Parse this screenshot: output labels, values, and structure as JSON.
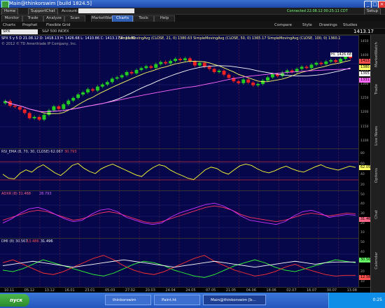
{
  "window": {
    "title": "Main@thinkorswim [build 1824.5]",
    "minimize": "_",
    "maximize": "□",
    "close": "×"
  },
  "toolbar": {
    "home": "Home",
    "support_chat": "SupportChat",
    "account_label": "Account:",
    "status": "Connected 22.08.12 00:25:11 CDT",
    "setup": "Setup"
  },
  "nav_tabs": [
    {
      "label": "Monitor"
    },
    {
      "label": "Trade"
    },
    {
      "label": "Analyze"
    },
    {
      "label": "Scan"
    },
    {
      "label": "MarketWatch"
    },
    {
      "label": "Charts",
      "active": true
    },
    {
      "label": "Tools"
    },
    {
      "label": "Help"
    }
  ],
  "subbar": {
    "charts": "Charts",
    "prophet": "Prophet",
    "flexible_grid": "Flexible Grid",
    "style": "Style",
    "drawings": "Drawings",
    "studies": "Studies",
    "zoom": "Zoom",
    "compare": "Compare"
  },
  "symbol": {
    "value": "SPX",
    "description": "S&P 500 INDEX",
    "last": "1413.17"
  },
  "price_pane": {
    "header": "SPX 5 y 5 D   21.08.12 O: 1418.13  H: 1426.68  L: 1410.86  C: 1413.17  R: 15.82",
    "studies": "SimpleMovingAvg (CLOSE, 21, 0)  1380.63   SimpleMovingAvg (CLOSE, 50, 0)  1365.17   SimpleMovingAvg (CLOSE, 100, 0)  1360.1",
    "copyright": "© 2012 © TD Ameritrade IP Company, Inc.",
    "hi_label": "Hi: 1426.68",
    "tags": [
      {
        "text": "1413.17",
        "color": "#ff5050"
      },
      {
        "text": "1380.63",
        "color": "#ffff66"
      },
      {
        "text": "1365.17",
        "color": "#ffffff"
      },
      {
        "text": "1331.87",
        "color": "#ff66ff"
      }
    ],
    "axis": [
      "1450",
      "1400",
      "1350",
      "1300",
      "1250",
      "1200",
      "1150",
      "1100"
    ]
  },
  "rsi_pane": {
    "header": "RSI_EMA (8, 70, 30, CLOSE)  62.067",
    "header_val2": "30.793",
    "tag": "62.0589",
    "axis": [
      "80",
      "60",
      "40",
      "20"
    ]
  },
  "adx_pane": {
    "header": "ADXR (8)  31.468",
    "header_val2": "28.793",
    "tag": "31.4654",
    "axis": [
      "50",
      "40",
      "30",
      "20",
      "10"
    ]
  },
  "dmi_pane": {
    "header": "DMI (8)  30.567",
    "header_val2": "13.486",
    "header_val3": "31.496",
    "tags": [
      {
        "text": "30.5689",
        "color": "#66ff66"
      },
      {
        "text": "12.5899",
        "color": "#ff5050"
      }
    ],
    "axis": [
      "50",
      "40",
      "30",
      "20",
      "10"
    ]
  },
  "xaxis": [
    "10.11",
    "05.12",
    "13.12",
    "16.01",
    "23.01",
    "05.03",
    "27.02",
    "20.03",
    "24.04",
    "24.05",
    "07.05",
    "21.05",
    "04.06",
    "18.06",
    "02.07",
    "16.07",
    "30.07",
    "13.08"
  ],
  "sidebar": [
    "MarketWatch",
    "Trade",
    "Live News",
    "Options",
    "Chat",
    "Calendar"
  ],
  "taskbar": {
    "start": "пуск",
    "tasks": [
      {
        "label": "thinkorswim"
      },
      {
        "label": "Paint.ht"
      },
      {
        "label": "Main@thinkorswim [b..."
      }
    ],
    "clock": "0:25"
  },
  "chart_data": [
    {
      "type": "candlestick",
      "title": "SPX",
      "note": "approximate daily closes read from gridlines",
      "ylim": [
        1100,
        1450
      ],
      "values": [
        1250,
        1232,
        1228,
        1218,
        1205,
        1185,
        1190,
        1180,
        1198,
        1215,
        1230,
        1220,
        1238,
        1252,
        1262,
        1275,
        1283,
        1295,
        1290,
        1305,
        1313,
        1322,
        1335,
        1340,
        1348,
        1360,
        1355,
        1368,
        1375,
        1382,
        1376,
        1390,
        1398,
        1393,
        1402,
        1410,
        1405,
        1412,
        1400,
        1385,
        1395,
        1380,
        1372,
        1360,
        1365,
        1350,
        1338,
        1325,
        1318,
        1332,
        1320,
        1310,
        1315,
        1328,
        1340,
        1352,
        1345,
        1358,
        1366,
        1360,
        1372,
        1380,
        1375,
        1388,
        1395,
        1390,
        1400,
        1405,
        1398,
        1410,
        1418,
        1413
      ]
    },
    {
      "type": "line",
      "title": "RSI_EMA (8, 70, 30, CLOSE)",
      "ylim": [
        0,
        100
      ],
      "values": [
        42,
        30,
        28,
        45,
        55,
        48,
        62,
        70,
        58,
        46,
        38,
        52,
        68,
        74,
        60,
        50,
        44,
        58,
        66,
        72,
        64,
        56,
        48,
        40,
        35,
        50,
        62,
        70,
        66,
        54,
        45,
        38,
        30,
        26,
        40,
        55,
        63,
        59,
        48,
        42,
        55,
        67,
        72,
        68,
        58,
        50,
        46,
        52,
        60,
        66,
        58,
        52,
        48,
        56,
        64,
        70,
        62,
        58,
        54,
        60,
        66,
        62
      ]
    },
    {
      "type": "line",
      "title": "ADXR (8)",
      "series": [
        {
          "name": "ADXR",
          "values": [
            22,
            26,
            30,
            34,
            36,
            34,
            30,
            26,
            22,
            24,
            28,
            32,
            34,
            32,
            28,
            24,
            20,
            18,
            20,
            24,
            28,
            32,
            36,
            40,
            42,
            40,
            36,
            30,
            26,
            24,
            22,
            20,
            22,
            26,
            30,
            32,
            30,
            28,
            30,
            32,
            31
          ]
        },
        {
          "name": "ADX",
          "values": [
            18,
            24,
            32,
            38,
            40,
            36,
            30,
            24,
            20,
            22,
            30,
            36,
            38,
            34,
            26,
            22,
            18,
            16,
            18,
            26,
            32,
            36,
            40,
            44,
            46,
            42,
            36,
            28,
            22,
            20,
            18,
            16,
            20,
            28,
            34,
            36,
            32,
            26,
            28,
            30,
            29
          ]
        }
      ],
      "ylim": [
        0,
        55
      ]
    },
    {
      "type": "line",
      "title": "DMI (8)",
      "series": [
        {
          "name": "DI+",
          "values": [
            20,
            18,
            22,
            28,
            34,
            30,
            26,
            22,
            18,
            14,
            12,
            16,
            22,
            28,
            32,
            30,
            26,
            20,
            16,
            12,
            10,
            14,
            20,
            26,
            30,
            34,
            30,
            24,
            20,
            18,
            22,
            26,
            30,
            34,
            32,
            30
          ]
        },
        {
          "name": "DI-",
          "values": [
            30,
            34,
            28,
            22,
            16,
            14,
            18,
            24,
            30,
            36,
            40,
            34,
            26,
            20,
            16,
            14,
            18,
            24,
            30,
            36,
            40,
            32,
            26,
            20,
            16,
            12,
            14,
            18,
            24,
            28,
            22,
            18,
            14,
            12,
            13,
            13
          ]
        },
        {
          "name": "ADX",
          "values": [
            26,
            28,
            30,
            32,
            30,
            28,
            26,
            24,
            26,
            28,
            30,
            32,
            34,
            32,
            30,
            28,
            26,
            24,
            26,
            28,
            30,
            32,
            30,
            28,
            26,
            24,
            26,
            28,
            30,
            32,
            30,
            28,
            30,
            31,
            31,
            31
          ]
        }
      ],
      "ylim": [
        0,
        55
      ]
    }
  ],
  "colors": {
    "pane_bg": "#06064a",
    "up": "#22cc22",
    "down": "#ee2222",
    "sma21": "#ffff66",
    "sma50": "#ffffff",
    "sma100": "#ff66ff",
    "rsi": "#ffff33",
    "adxr": "#ff3366",
    "adx": "#cc33ff",
    "di_plus": "#33ff33",
    "di_minus": "#ff3333",
    "dmi_adx": "#ffffff"
  }
}
